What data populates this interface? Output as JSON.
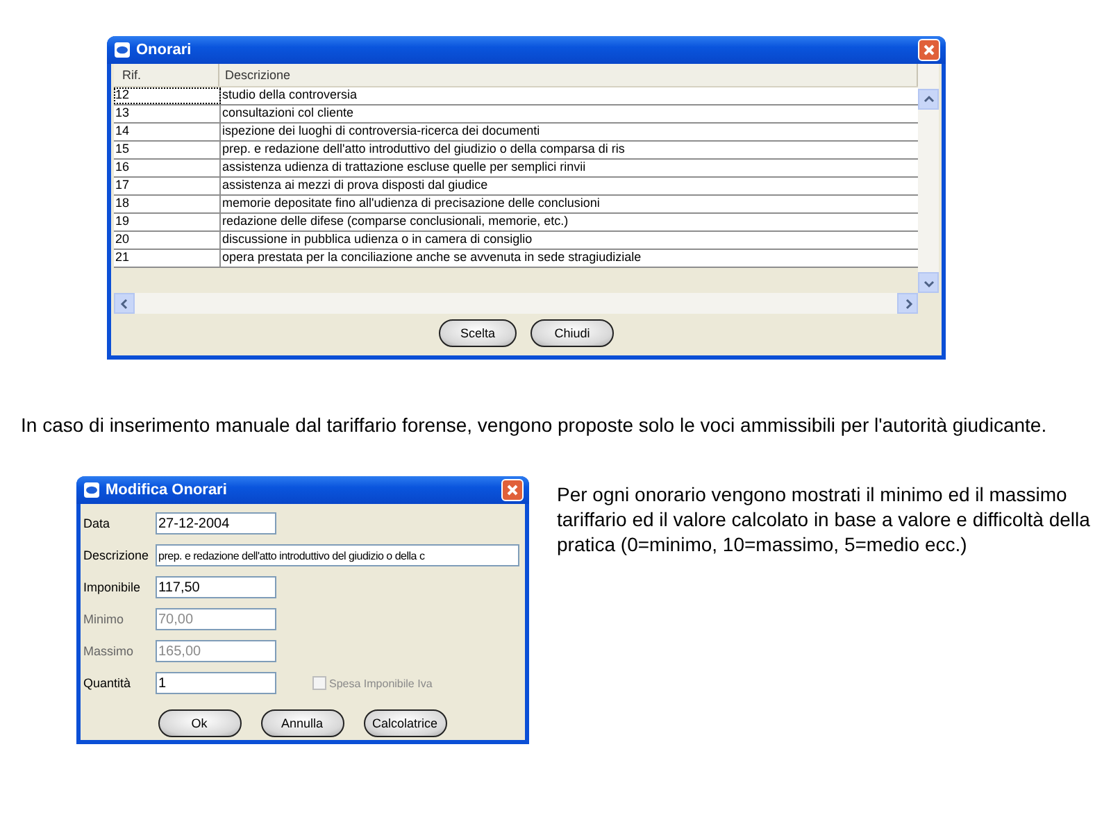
{
  "onorari_window": {
    "title": "Onorari",
    "columns": [
      "Rif.",
      "Descrizione"
    ],
    "rows": [
      {
        "rif": "12",
        "descrizione": "studio della controversia",
        "selected": true
      },
      {
        "rif": "13",
        "descrizione": "consultazioni col cliente",
        "selected": false
      },
      {
        "rif": "14",
        "descrizione": "ispezione dei luoghi di controversia-ricerca dei documenti",
        "selected": false
      },
      {
        "rif": "15",
        "descrizione": "prep. e redazione dell'atto introduttivo del giudizio o della comparsa di ris",
        "selected": false
      },
      {
        "rif": "16",
        "descrizione": "assistenza udienza di trattazione escluse quelle per semplici rinvii",
        "selected": false
      },
      {
        "rif": "17",
        "descrizione": "assistenza ai mezzi di prova disposti dal giudice",
        "selected": false
      },
      {
        "rif": "18",
        "descrizione": "memorie depositate fino all'udienza di precisazione delle conclusioni",
        "selected": false
      },
      {
        "rif": "19",
        "descrizione": "redazione delle difese (comparse conclusionali, memorie, etc.)",
        "selected": false
      },
      {
        "rif": "20",
        "descrizione": "discussione in pubblica udienza o in camera di consiglio",
        "selected": false
      },
      {
        "rif": "21",
        "descrizione": "opera prestata per la conciliazione anche se avvenuta in sede stragiudiziale",
        "selected": false
      }
    ],
    "buttons": [
      "Scelta",
      "Chiudi"
    ]
  },
  "note_1": "In caso di inserimento manuale dal tariffario forense, vengono proposte solo le voci ammissibili per l'autorità giudicante.",
  "modifica_window": {
    "title": "Modifica Onorari",
    "fields": [
      {
        "label": "Data",
        "value": "27-12-2004",
        "disabled": false,
        "wide": false
      },
      {
        "label": "Descrizione",
        "value": "prep. e redazione dell'atto introduttivo del giudizio o della c",
        "disabled": false,
        "wide": true
      },
      {
        "label": "Imponibile",
        "value": "117,50",
        "disabled": false,
        "wide": false
      },
      {
        "label": "Minimo",
        "value": "70,00",
        "disabled": true,
        "wide": false
      },
      {
        "label": "Massimo",
        "value": "165,00",
        "disabled": true,
        "wide": false
      },
      {
        "label": "Quantità",
        "value": "1",
        "disabled": false,
        "wide": false
      }
    ],
    "checkbox": {
      "label": "Spesa Imponibile Iva",
      "checked": false,
      "disabled": true
    },
    "buttons": [
      "Ok",
      "Annulla",
      "Calcolatrice"
    ]
  },
  "note_2": "Per ogni onorario vengono mostrati il minimo ed il massimo tariffario ed il valore calcolato in base a valore e difficoltà della pratica (0=minimo, 10=massimo, 5=medio ecc.)"
}
